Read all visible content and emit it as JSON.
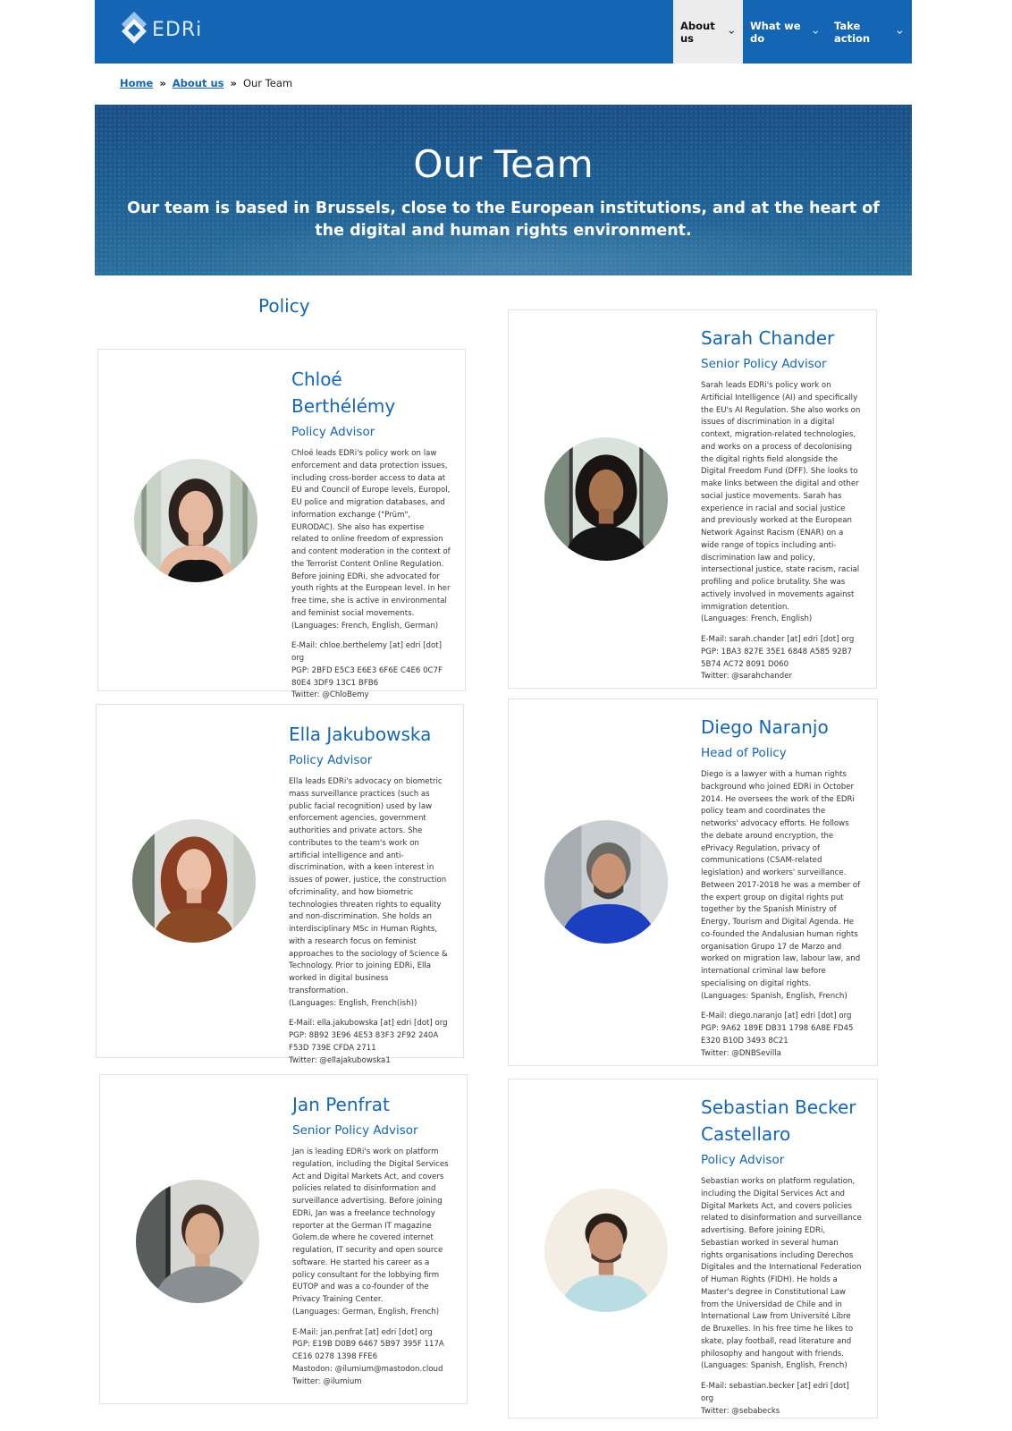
{
  "header": {
    "logo_text": "EDRi",
    "nav": [
      {
        "label": "About us",
        "active": true
      },
      {
        "label": "What we do",
        "active": false
      },
      {
        "label": "Take action",
        "active": false
      }
    ],
    "colors": {
      "brand": "#1466b5",
      "active_bg": "#ececec"
    }
  },
  "breadcrumb": {
    "home": "Home",
    "about": "About us",
    "current": "Our Team",
    "separator": "»"
  },
  "hero": {
    "title": "Our Team",
    "subtitle": "Our team is based in Brussels, close to the European institutions, and at the heart of the digital and human rights environment."
  },
  "section": {
    "title": "Policy"
  },
  "members": [
    {
      "name": "Chloé Berthélémy",
      "role": "Policy Advisor",
      "bio": "Chloé leads EDRi's policy work on law enforcement and data protection issues, including cross-border access to data at EU and Council of Europe levels, Europol, EU police and migration databases, and information exchange (\"Prüm\", EURODAC). She also has expertise related to online freedom of expression and content moderation in the context of the Terrorist Content Online Regulation. Before joining EDRi, she advocated for youth rights at the European level. In her free time, she is active in environmental and feminist social movements.",
      "languages": "(Languages: French, English, German)",
      "email": "E-Mail: chloe.berthelemy [at] edri [dot] org",
      "pgp": "PGP: 2BFD E5C3 E6E3 6F6E C4E6 0C7F 80E4 3DF9 13C1 BFB6",
      "mastodon": "",
      "twitter": "Twitter: @ChloBemy"
    },
    {
      "name": "Sarah Chander",
      "role": "Senior Policy Advisor",
      "bio": "Sarah leads EDRi's policy work on Artificial Intelligence (AI) and specifically the EU's AI Regulation. She also works on issues of discrimination in a digital context, migration-related technologies, and works on a process of decolonising the digital rights field alongside the Digital Freedom Fund (DFF). She looks to make links between the digital and other social justice movements. Sarah has experience in racial and social justice and previously worked at the European Network Against Racism (ENAR) on a wide range of topics including anti-discrimination law and policy, intersectional justice, state racism, racial profiling and police brutality. She was actively involved in movements against immigration detention.",
      "languages": "(Languages: French, English)",
      "email": "E-Mail: sarah.chander [at] edri [dot] org",
      "pgp": "PGP: 1BA3 827E 35E1 6848 A585 92B7 5B74 AC72 8091 D060",
      "mastodon": "",
      "twitter": "Twitter: @sarahchander"
    },
    {
      "name": "Ella Jakubowska",
      "role": "Policy Advisor",
      "bio": "Ella leads EDRi's advocacy on biometric mass surveillance practices (such as public facial recognition) used by law enforcement agencies, government authorities and private actors. She contributes to the team's work on artificial intelligence and anti-discrimination, with a keen interest in issues of power, justice, the construction ofcriminality, and how biometric technologies threaten rights to equality and non-discrimination. She holds an interdisciplinary MSc in Human Rights, with a research focus on feminist approaches to the sociology of Science & Technology. Prior to joining EDRi, Ella worked in digital business transformation.",
      "languages": "(Languages: English, French(ish))",
      "email": "E-Mail: ella.jakubowska [at] edri [dot] org",
      "pgp": "PGP: 8B92 3E96 4E53 83F3 2F92 240A F53D 739E CFDA 2711",
      "mastodon": "",
      "twitter": "Twitter: @ellajakubowska1"
    },
    {
      "name": "Diego Naranjo",
      "role": "Head of Policy",
      "bio": "Diego is a lawyer with a human rights background who joined EDRi in October 2014. He oversees the work of the EDRi policy team and coordinates the networks' advocacy efforts. He follows the debate around encryption, the ePrivacy Regulation, privacy of communications (CSAM-related legislation) and workers' surveillance. Between 2017-2018 he was a member of the expert group on digital rights put together by the Spanish Ministry of Energy, Tourism and Digital Agenda. He co-founded the Andalusian human rights organisation Grupo 17 de Marzo and worked on migration law, labour law, and international criminal law before specialising on digital rights.",
      "languages": "(Languages: Spanish, English, French)",
      "email": "E-Mail: diego.naranjo [at] edri [dot] org",
      "pgp": "PGP: 9A62 189E DB31 1798 6A8E FD45 E320 B10D 3493 8C21",
      "mastodon": "",
      "twitter": "Twitter: @DNBSevilla"
    },
    {
      "name": "Jan Penfrat",
      "role": "Senior Policy Advisor",
      "bio": "Jan is leading EDRi's work on platform regulation, including the Digital Services Act and Digital Markets Act, and covers policies related to disinformation and surveillance advertising. Before joining EDRi, Jan was a freelance technology reporter at the German IT magazine Golem.de where he covered internet regulation, IT security and open source software. He started his career as a policy consultant for the lobbying firm EUTOP and was a co-founder of the Privacy Training Center.",
      "languages": "(Languages: German, English, French)",
      "email": "E-Mail: jan.penfrat [at] edri [dot] org",
      "pgp": "PGP: E19B D0B9 6467 5B97 395F 117A CE16 0278 1398 FFE6",
      "mastodon": "Mastodon: @ilumium@mastodon.cloud",
      "twitter": "Twitter: @ilumium"
    },
    {
      "name": "Sebastian Becker Castellaro",
      "role": "Policy Advisor",
      "bio": "Sebastian works on platform regulation, including the Digital Services Act and Digital Markets Act, and covers policies related to disinformation and surveillance advertising. Before joining EDRi, Sebastian worked in several human rights organisations including Derechos Digitales and the International Federation of Human Rights (FIDH). He holds a Master's degree in Constitutional Law from the Universidad de Chile and in International Law from Université Libre de Bruxelles. In his free time he likes to skate, play football, read literature and philosophy and hangout with friends.",
      "languages": "(Languages: Spanish, English, French)",
      "email": "E-Mail: sebastian.becker [at] edri [dot] org",
      "pgp": "",
      "mastodon": "",
      "twitter": "Twitter: @sebabecks"
    }
  ]
}
